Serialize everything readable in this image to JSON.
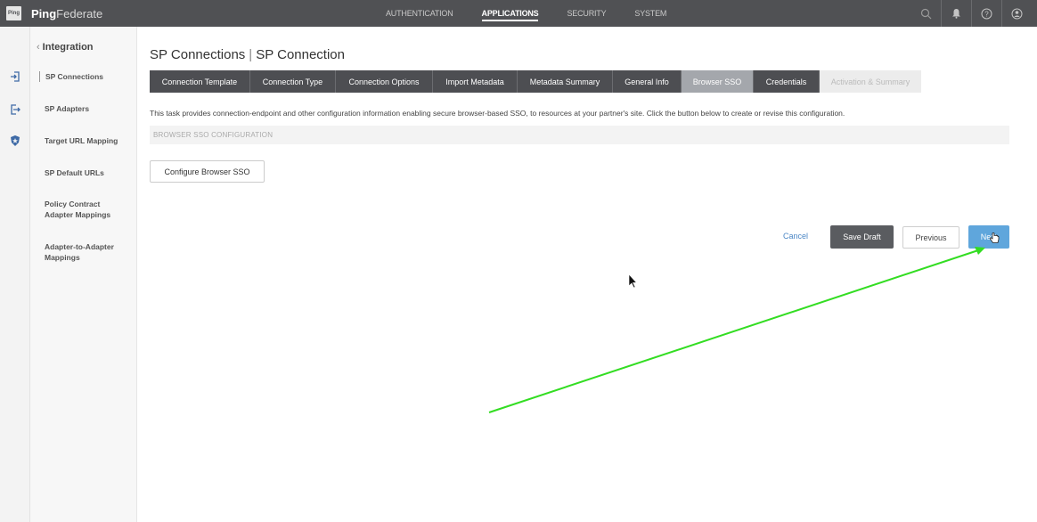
{
  "header": {
    "logo_text": "Ping",
    "brand_bold": "Ping",
    "brand_rest": "Federate",
    "nav": [
      {
        "label": "AUTHENTICATION",
        "active": false
      },
      {
        "label": "APPLICATIONS",
        "active": true
      },
      {
        "label": "SECURITY",
        "active": false
      },
      {
        "label": "SYSTEM",
        "active": false
      }
    ],
    "icons": [
      "search-icon",
      "bell-icon",
      "help-icon",
      "user-icon"
    ]
  },
  "rail": {
    "icons": [
      "sign-in-icon",
      "sign-out-icon",
      "shield-star-icon"
    ]
  },
  "sidebar": {
    "back_label": "Integration",
    "items": [
      {
        "label": "SP Connections",
        "active": true
      },
      {
        "label": "SP Adapters",
        "active": false
      },
      {
        "label": "Target URL Mapping",
        "active": false
      },
      {
        "label": "SP Default URLs",
        "active": false
      },
      {
        "label": "Policy Contract Adapter Mappings",
        "active": false
      },
      {
        "label": "Adapter-to-Adapter Mappings",
        "active": false
      }
    ]
  },
  "main": {
    "title_part1": "SP Connections",
    "title_part2": "SP Connection",
    "tabs": [
      {
        "label": "Connection Template",
        "state": "normal"
      },
      {
        "label": "Connection Type",
        "state": "normal"
      },
      {
        "label": "Connection Options",
        "state": "normal"
      },
      {
        "label": "Import Metadata",
        "state": "normal"
      },
      {
        "label": "Metadata Summary",
        "state": "normal"
      },
      {
        "label": "General Info",
        "state": "normal"
      },
      {
        "label": "Browser SSO",
        "state": "active"
      },
      {
        "label": "Credentials",
        "state": "normal"
      },
      {
        "label": "Activation & Summary",
        "state": "disabled"
      }
    ],
    "description": "This task provides connection-endpoint and other configuration information enabling secure browser-based SSO, to resources at your partner's site. Click the button below to create or revise this configuration.",
    "section_header": "BROWSER SSO CONFIGURATION",
    "configure_button": "Configure Browser SSO"
  },
  "footer_buttons": {
    "cancel": "Cancel",
    "save_draft": "Save Draft",
    "previous": "Previous",
    "next": "Next"
  },
  "colors": {
    "topbar": "#505154",
    "tab_bg": "#4d4e52",
    "tab_active": "#a4a7ac",
    "next_button": "#5fa6dc",
    "annotation_arrow": "#33dd22"
  }
}
